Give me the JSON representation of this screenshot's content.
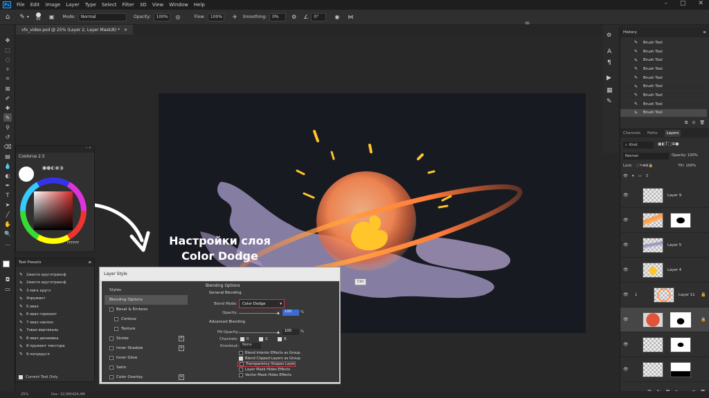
{
  "menu": {
    "ps": "Ps",
    "items": [
      "File",
      "Edit",
      "Image",
      "Layer",
      "Type",
      "Select",
      "Filter",
      "3D",
      "View",
      "Window",
      "Help"
    ]
  },
  "options": {
    "size": "60",
    "mode_label": "Mode:",
    "mode": "Normal",
    "opacity_label": "Opacity:",
    "opacity": "100%",
    "flow_label": "Flow:",
    "flow": "100%",
    "smoothing_label": "Smoothing:",
    "smoothing": "0%",
    "angle": "0°"
  },
  "document": {
    "tab": "vfx_video.psd @ 25% (Layer 2, Layer Mask/8) *",
    "close": "×"
  },
  "status": {
    "zoom": "25%",
    "doc": "Doc: 32,0M/424,4M"
  },
  "color_panel": {
    "title": "Coolorus 2.5",
    "hex": "FFFFFF"
  },
  "tool_presets": {
    "title": "Tool Presets",
    "items": [
      "2жестк круглтрансф",
      "2жестк круглтрансф",
      "3 мягк кругл",
      "4пружинт",
      "5 овал",
      "6 овал горизонт",
      "7 овал наклон",
      "7овал вертикаль",
      "8 овал динамика",
      "8 пружинт текстура",
      "9 попукругл"
    ],
    "current_only": "Current Tool Only"
  },
  "overlay": {
    "line1": "Настройки слоя",
    "line2": "Color Dodge"
  },
  "tooltip": "Ctrl",
  "layer_style": {
    "title": "Layer Style",
    "left": [
      {
        "label": "Styles",
        "cb": false,
        "plus": false,
        "sel": false
      },
      {
        "label": "Blending Options",
        "cb": false,
        "plus": false,
        "sel": true
      },
      {
        "label": "Bevel & Emboss",
        "cb": true,
        "plus": false,
        "sel": false
      },
      {
        "label": "Contour",
        "cb": true,
        "plus": false,
        "sel": false,
        "indent": true
      },
      {
        "label": "Texture",
        "cb": true,
        "plus": false,
        "sel": false,
        "indent": true
      },
      {
        "label": "Stroke",
        "cb": true,
        "plus": true,
        "sel": false
      },
      {
        "label": "Inner Shadow",
        "cb": true,
        "plus": true,
        "sel": false
      },
      {
        "label": "Inner Glow",
        "cb": true,
        "plus": false,
        "sel": false
      },
      {
        "label": "Satin",
        "cb": true,
        "plus": false,
        "sel": false
      },
      {
        "label": "Color Overlay",
        "cb": true,
        "plus": true,
        "sel": false
      }
    ],
    "blending_options": "Blending Options",
    "general_blending": "General Blending",
    "blend_mode_label": "Blend Mode:",
    "blend_mode": "Color Dodge",
    "opacity_label": "Opacity:",
    "opacity_value": "100",
    "pct": "%",
    "advanced_blending": "Advanced Blending",
    "fill_opacity_label": "Fill Opacity:",
    "fill_opacity_value": "100",
    "channels_label": "Channels:",
    "channels": [
      "R",
      "G",
      "B"
    ],
    "knockout_label": "Knockout:",
    "knockout": "None",
    "options": [
      {
        "label": "Blend Interior Effects as Group",
        "checked": false
      },
      {
        "label": "Blend Clipped Layers as Group",
        "checked": true
      },
      {
        "label": "Transparency Shapes Layer",
        "checked": false,
        "highlight": true
      },
      {
        "label": "Layer Mask Hides Effects",
        "checked": false
      },
      {
        "label": "Vector Mask Hides Effects",
        "checked": false
      }
    ]
  },
  "history": {
    "title": "History",
    "items": [
      "Brush Tool",
      "Brush Tool",
      "Brush Tool",
      "Brush Tool",
      "Brush Tool",
      "Brush Tool",
      "Brush Tool",
      "Brush Tool",
      "Brush Tool"
    ]
  },
  "layers": {
    "tabs": [
      "Channels",
      "Paths",
      "Layers"
    ],
    "kind": "Kind",
    "mode": "Normal",
    "opacity_label": "Opacity:",
    "opacity": "100%",
    "lock_label": "Lock:",
    "fill_label": "Fill:",
    "fill": "100%",
    "group": "3",
    "rows": [
      {
        "name": "Layer 9"
      },
      {
        "name": ""
      },
      {
        "name": "Layer 5"
      },
      {
        "name": "Layer 4"
      },
      {
        "name": "Layer 11"
      },
      {
        "name": ""
      },
      {
        "name": ""
      },
      {
        "name": ""
      }
    ]
  },
  "colors": {
    "accent_red": "#e0313f",
    "orange": "#ff8a3d",
    "yellow": "#ffc52a",
    "lavender": "#9a8fb8"
  }
}
